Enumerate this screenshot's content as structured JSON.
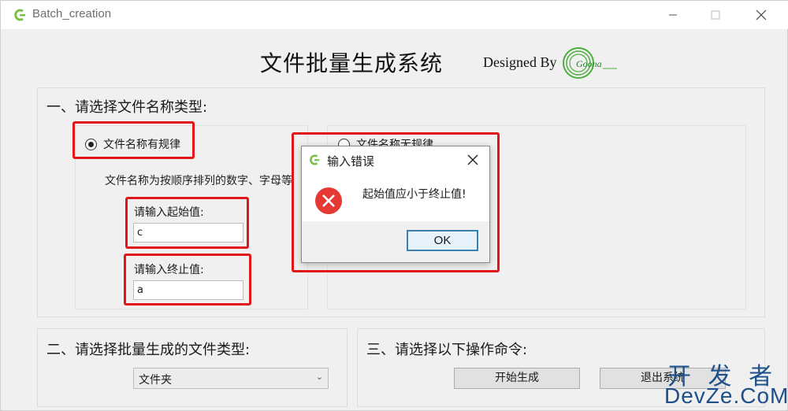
{
  "window": {
    "title": "Batch_creation"
  },
  "header": {
    "title": "文件批量生成系统",
    "designed_by": "Designed By"
  },
  "logo": {
    "text": "Goona"
  },
  "section1": {
    "label": "一、请选择文件名称类型:",
    "option_regular": "文件名称有规律",
    "option_irregular": "文件名称无规律",
    "description": "文件名称为按顺序排列的数字、字母等",
    "start_label": "请输入起始值:",
    "start_value": "c",
    "end_label": "请输入终止值:",
    "end_value": "a"
  },
  "section2": {
    "label": "二、请选择批量生成的文件类型:",
    "selected": "文件夹"
  },
  "section3": {
    "label": "三、请选择以下操作命令:",
    "start_button": "开始生成",
    "exit_button": "退出系统"
  },
  "dialog": {
    "title": "输入错误",
    "message": "起始值应小于终止值!",
    "ok": "OK"
  },
  "watermark": {
    "top": "开 发 者",
    "bottom": "DevZe.CoM"
  },
  "colors": {
    "highlight": "#e1161b",
    "error": "#e53935",
    "accent": "#3c7fb1"
  }
}
